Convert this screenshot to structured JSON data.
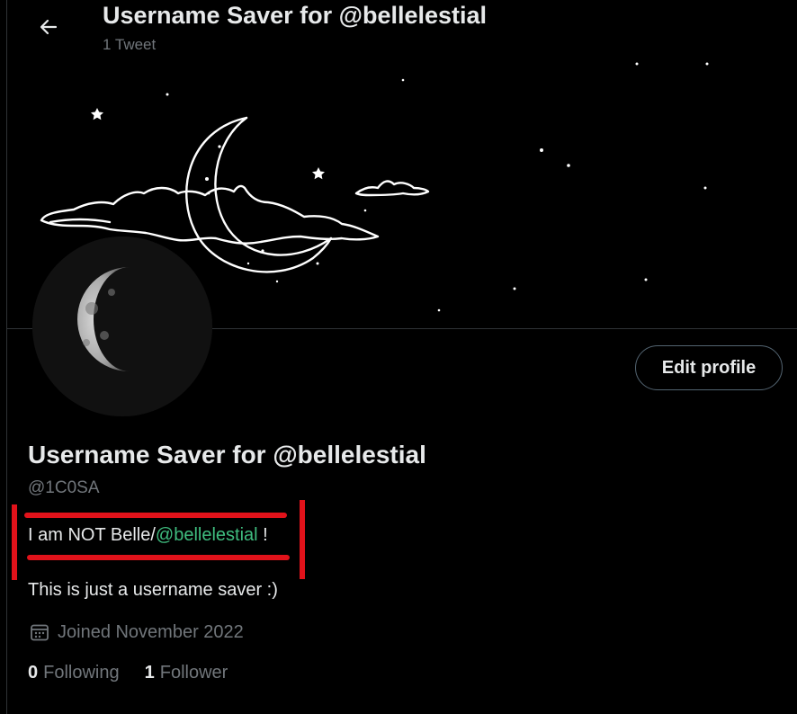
{
  "header": {
    "title": "Username Saver for @bellelestial",
    "tweet_count": "1 Tweet"
  },
  "profile": {
    "display_name": "Username Saver for @bellelestial",
    "handle": "@1C0SA",
    "edit_button": "Edit profile",
    "bio": {
      "line1_prefix": "I am NOT Belle/",
      "line1_mention": "@bellelestial",
      "line1_suffix": " !",
      "line2": "This is just a username saver  :)"
    },
    "joined": "Joined November 2022",
    "following_count": "0",
    "following_label": "Following",
    "followers_count": "1",
    "followers_label": "Follower"
  },
  "colors": {
    "background": "#000000",
    "text": "#e7e9ea",
    "secondary_text": "#71767b",
    "mention": "#3fbd7f",
    "annotation": "#e1121a"
  }
}
